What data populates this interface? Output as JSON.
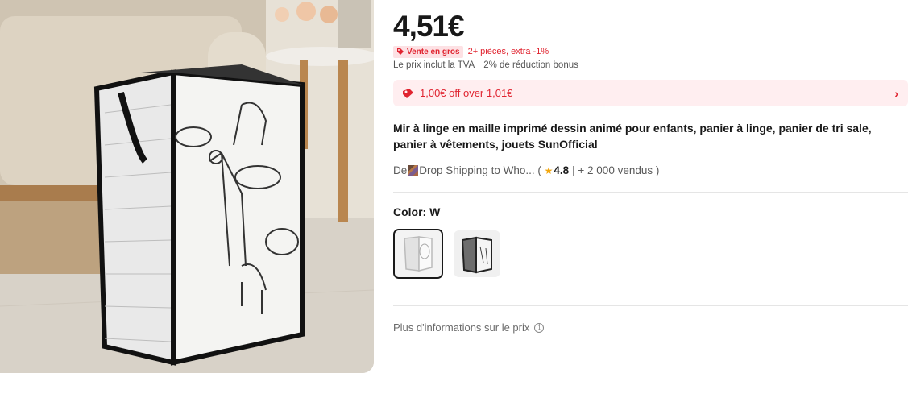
{
  "product": {
    "price": "4,51€",
    "wholesale_badge": "Vente en gros",
    "wholesale_text": "2+ pièces, extra -1%",
    "tax_text": "Le prix inclut la TVA",
    "bonus_text": "2% de réduction bonus",
    "coupon_text": "1,00€ off over 1,01€",
    "title": "Mir à linge en maille imprimé dessin animé pour enfants, panier à linge, panier de tri sale, panier à vêtements, jouets SunOfficial",
    "store_prefix": "De",
    "store_name": "Drop Shipping to Who...",
    "rating": "4.8",
    "sold": "+ 2 000 vendus",
    "color_label": "Color: W",
    "more_info": "Plus d'informations sur le prix"
  },
  "icons": {
    "tag": "tag-icon",
    "coupon": "coupon-ticket-icon",
    "arrow": "chevron-right-icon",
    "star": "star-icon",
    "info": "info-icon"
  },
  "colors": {
    "accent_red": "#e02430",
    "badge_bg": "#fde1e4",
    "coupon_bg": "#ffeef0",
    "star": "#f2a50a"
  }
}
